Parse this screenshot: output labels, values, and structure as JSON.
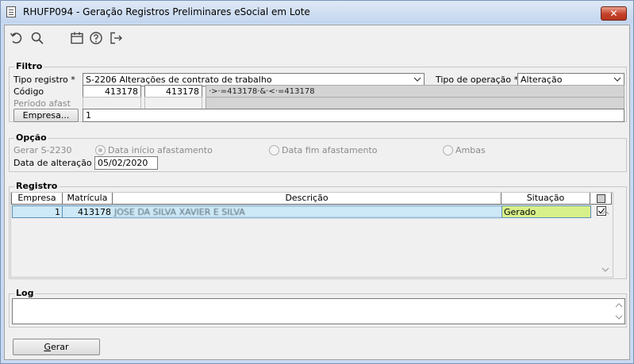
{
  "window": {
    "title": "RHUFP094 - Geração Registros Preliminares eSocial em Lote",
    "close_label": "✕"
  },
  "toolbar": {
    "icons": [
      "undo-icon",
      "search-icon",
      "calendar-icon",
      "help-icon",
      "exit-icon"
    ]
  },
  "filtro": {
    "legend": "Filtro",
    "tipo_registro_label": "Tipo registro *",
    "tipo_registro_value": "S-2206 Alterações de contrato de trabalho",
    "tipo_operacao_label": "Tipo de operação *",
    "tipo_operacao_value": "Alteração",
    "codigo_label": "Código",
    "codigo_from": "413178",
    "codigo_to": "413178",
    "codigo_expr": "·>·=413178·&·<·=413178",
    "periodo_label": "Período afast",
    "empresa_button": "Empresa...",
    "empresa_value": "1"
  },
  "opcao": {
    "legend": "Opção",
    "gerar_label": "Gerar S-2230",
    "radio_inicio": "Data início afastamento",
    "radio_fim": "Data fim afastamento",
    "radio_ambas": "Ambas",
    "data_alteracao_label": "Data de alteração",
    "data_alteracao_value": "05/02/2020"
  },
  "registro": {
    "legend": "Registro",
    "columns": [
      "Empresa",
      "Matrícula",
      "Descrição",
      "Situação"
    ],
    "rows": [
      {
        "empresa": "1",
        "matricula": "413178",
        "descricao": "JOSE DA SILVA XAVIER E SILVA",
        "situacao": "Gerado",
        "checked": true
      }
    ],
    "colors": {
      "row_bg": "#cde8f6",
      "situacao_bg": "#d8f08a"
    }
  },
  "log": {
    "legend": "Log"
  },
  "footer": {
    "gerar_prefix": "G",
    "gerar_rest": "erar"
  }
}
